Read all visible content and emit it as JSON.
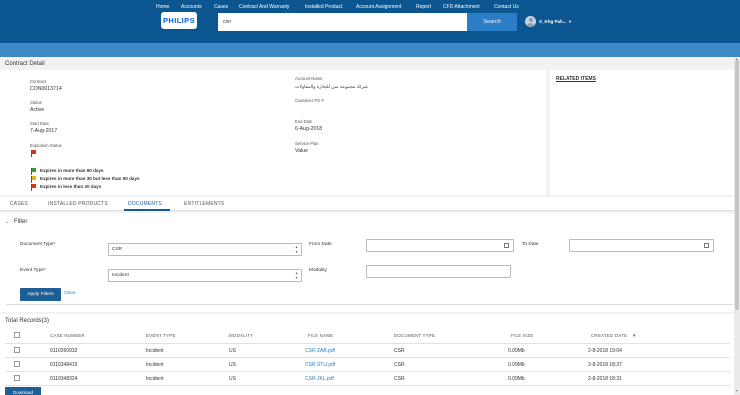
{
  "header": {
    "logo": "PHILIPS",
    "search_value": "con",
    "search_button": "Search",
    "username": "S_Khg Pah..."
  },
  "nav": [
    "Home",
    "Accounts",
    "Cases",
    "Contract And Warranty",
    "Installed Product",
    "Account Assignment",
    "Report",
    "CFD Attachment",
    "Contact Us"
  ],
  "contract_detail": {
    "title": "Contract Detail",
    "contract_label": "Contract",
    "contract_value": "CON0013714",
    "account_name_label": "Account Name",
    "account_name_value": "شركة مجموعة سن للتجارة والمقاولات",
    "status_label": "Status",
    "status_value": "Active",
    "customer_po_label": "Customer PO #",
    "start_date_label": "Start Date",
    "start_date_value": "7-Aug-2017",
    "end_date_label": "End Date",
    "end_date_value": "6-Aug-2018",
    "expiration_label": "Expiration Status",
    "service_plan_label": "Service Plan",
    "service_plan_value": "Value",
    "legend": [
      {
        "color": "green",
        "text": "Expires in more than 90 days"
      },
      {
        "color": "yellow",
        "text": "Expires in more than 30 but less than 90 days"
      },
      {
        "color": "red",
        "text": "Expires in less than 30 days"
      }
    ]
  },
  "related_items": {
    "title": "RELATED ITEMS"
  },
  "tabs": [
    "CASES",
    "INSTALLED PRODUCTS",
    "DOCUMENTS",
    "ENTITLEMENTS"
  ],
  "active_tab": "DOCUMENTS",
  "filter": {
    "title": "Filter",
    "document_type_label": "Document Type*",
    "document_type_value": "CSR",
    "event_type_label": "Event Type*",
    "event_type_value": "Incident",
    "from_date_label": "From Date",
    "to_date_label": "To Date",
    "modality_label": "Modality",
    "apply_label": "Apply Filters",
    "clear_label": "Clear"
  },
  "records": {
    "title": "Total Records(3)",
    "columns": [
      "CASE NUMBER",
      "EVENT TYPE",
      "MODALITY",
      "FILE NAME",
      "DOCUMENT TYPE",
      "FILE SIZE",
      "CREATED DATE"
    ],
    "sort_indicator": "▼",
    "rows": [
      {
        "case_number": "0110260932",
        "event_type": "Incident",
        "modality": "US",
        "file_name": "CSR ZAB.pdf",
        "document_type": "CSR",
        "file_size": "0.09Mb",
        "created_date": "2-8-2018 19:04"
      },
      {
        "case_number": "0110348419",
        "event_type": "Incident",
        "modality": "US",
        "file_name": "CSR STU.pdf",
        "document_type": "CSR",
        "file_size": "0.09Mb",
        "created_date": "2-8-2018 18:37"
      },
      {
        "case_number": "0110348324",
        "event_type": "Incident",
        "modality": "US",
        "file_name": "CSR JKL.pdf",
        "document_type": "CSR",
        "file_size": "0.09Mb",
        "created_date": "2-8-2018 18:31"
      }
    ],
    "download_label": "Download"
  }
}
